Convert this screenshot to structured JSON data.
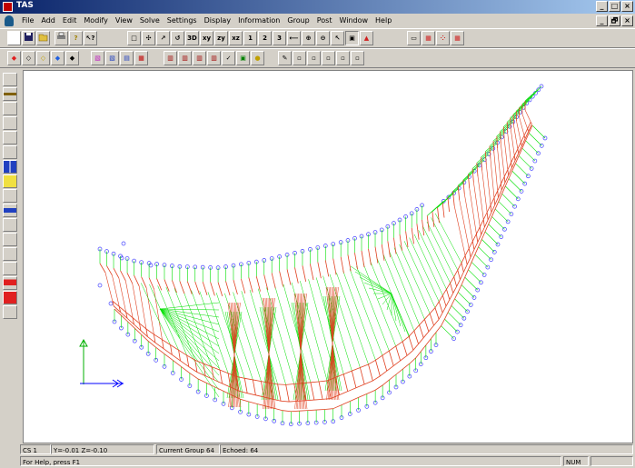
{
  "window": {
    "title": "TAS",
    "controls": [
      "_",
      "□",
      "×"
    ]
  },
  "mdi_controls": [
    "_",
    "🗗",
    "×"
  ],
  "menu": {
    "items": [
      "File",
      "Add",
      "Edit",
      "Modify",
      "View",
      "Solve",
      "Settings",
      "Display",
      "Information",
      "Group",
      "Post",
      "Window",
      "Help"
    ]
  },
  "toolbar1": {
    "left": [
      "new-icon",
      "open-icon",
      "save-icon",
      "print-icon",
      "hint-icon",
      "help-icon"
    ],
    "view_buttons": [
      "□",
      "✣",
      "↗",
      "↺",
      "3D",
      "xy",
      "zy",
      "xz",
      "1",
      "2",
      "3",
      "⟵",
      "⊕",
      "⊖",
      "↖",
      "▣",
      "▲"
    ],
    "right": [
      "▭",
      "▦",
      "⁘",
      "▦"
    ]
  },
  "toolbar2": {
    "groupA": [
      "◆",
      "◇",
      "◇",
      "◆",
      "◆"
    ],
    "groupB": [
      "▧",
      "▧",
      "▤",
      "▦"
    ],
    "groupC": [
      "▥",
      "▥",
      "▥",
      "▥",
      "✓",
      "▣",
      "●"
    ],
    "groupD": [
      "✎",
      "▫",
      "▫",
      "▫",
      "▫",
      "▫"
    ]
  },
  "colors": {
    "mesh_green": "#00e000",
    "mesh_red": "#e04020",
    "node_blue": "#4040ff",
    "triad_green": "#00b000",
    "triad_blue": "#0000ff"
  },
  "status": {
    "cs": "CS 1",
    "coords": "Y=-0.01 Z=-0.10",
    "group": "Current Group 64",
    "echoed": "Echoed: 64",
    "help": "For Help, press F1",
    "num": "NUM"
  }
}
